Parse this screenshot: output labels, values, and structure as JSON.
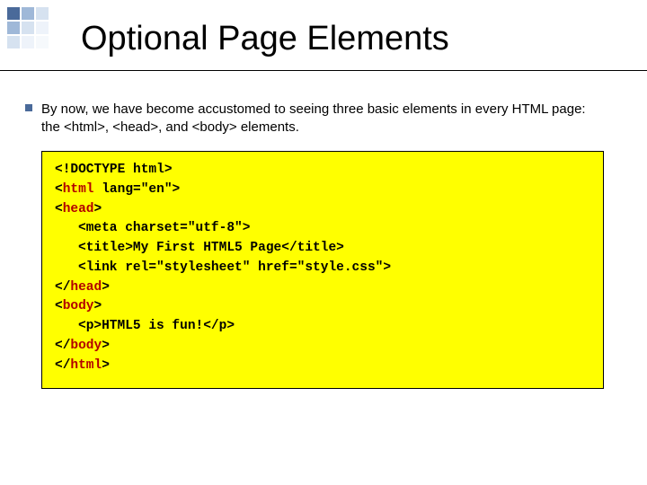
{
  "title": "Optional Page Elements",
  "intro": "By now, we have become accustomed to seeing three basic elements in every HTML page: the <html>, <head>, and <body> elements.",
  "code": {
    "l1": "<!DOCTYPE html>",
    "l2a": "<",
    "l2b": "html",
    "l2c": " lang=\"en\">",
    "l3a": "<",
    "l3b": "head",
    "l3c": ">",
    "l4": "<meta charset=\"utf-8\">",
    "l5": "<title>My First HTML5 Page</title>",
    "l6": "<link rel=\"stylesheet\" href=\"style.css\">",
    "l7a": "</",
    "l7b": "head",
    "l7c": ">",
    "l8a": "<",
    "l8b": "body",
    "l8c": ">",
    "l9": "<p>HTML5 is fun!</p>",
    "l10a": "</",
    "l10b": "body",
    "l10c": ">",
    "l11a": "</",
    "l11b": "html",
    "l11c": ">"
  }
}
